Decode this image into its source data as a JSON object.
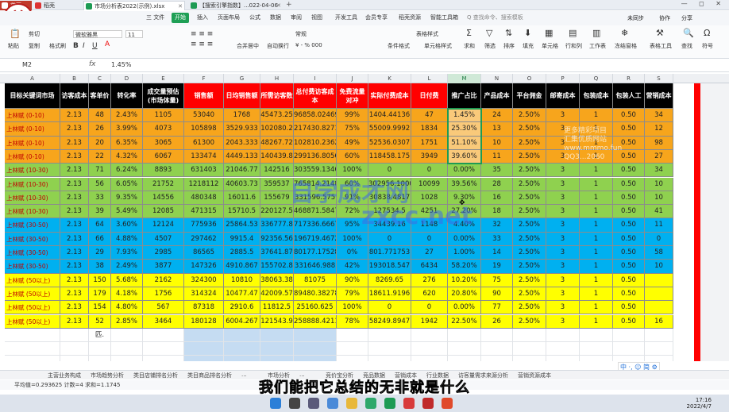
{
  "titlebar": {
    "tabs": [
      "首页",
      "稻壳",
      "市场分析表2022(示例).xlsx",
      "【搜索引擎指数】...022-04-06"
    ],
    "window_controls": "— ◻ ✕"
  },
  "ribbon": {
    "menus": [
      "三 文件",
      "开始",
      "插入",
      "页面布局",
      "公式",
      "数据",
      "审阅",
      "视图",
      "开发工具",
      "会员专享",
      "稻壳资源",
      "智能工具箱"
    ],
    "active_menu": "开始",
    "search_placeholder": "Q 查找命令、搜索模板",
    "right_tools": [
      "未同步",
      "协作",
      "分享"
    ]
  },
  "toolbar": {
    "paste": "粘贴",
    "cut": "剪切",
    "copy": "复制",
    "format_painter": "格式刷",
    "font_name": "微软雅黑",
    "font_size": "11",
    "merge": "合并居中",
    "wrap": "自动换行",
    "number_format": "常规",
    "table_style": "表格样式",
    "cond_format": "条件格式",
    "cell_style": "单元格样式",
    "sum": "求和",
    "filter": "筛选",
    "sort": "排序",
    "fill": "填充",
    "cell": "单元格",
    "rowcol": "行和列",
    "worksheet": "工作表",
    "freeze": "冻结窗格",
    "table_tools": "表格工具",
    "find": "查找",
    "symbol": "符号"
  },
  "formula_bar": {
    "name_box": "M2",
    "fx": "fx",
    "value": "1.45%"
  },
  "columns": [
    "A",
    "B",
    "C",
    "D",
    "E",
    "F",
    "G",
    "H",
    "I",
    "J",
    "K",
    "L",
    "M",
    "N",
    "O",
    "P",
    "Q",
    "R",
    "S"
  ],
  "selected_column": "M",
  "header_row": [
    "目标关键词市场",
    "访客成本",
    "客单价",
    "转化率",
    "成交量预估\n(市场体量)",
    "销售额",
    "日均销售额",
    "所需访客数",
    "总付费访客成本",
    "免费流量对冲",
    "实际付费成本",
    "日付费",
    "推广占比",
    "产品成本",
    "平台佣金",
    "邮寄成本",
    "包装成本",
    "包装人工",
    "营销成本"
  ],
  "rows": [
    [
      "上林赋 (0-10)",
      "2.13",
      "48",
      "2.43%",
      "1105",
      "53040",
      "1768",
      "45473.25",
      "96858.02469",
      "99%",
      "1404.44136",
      "47",
      "1.45%",
      "24",
      "2.50%",
      "3",
      "1",
      "0.50",
      "34"
    ],
    [
      "上林赋 (0-10)",
      "2.13",
      "26",
      "3.99%",
      "4073",
      "105898",
      "3529.933",
      "102080.2",
      "217430.8271",
      "75%",
      "55009.9992",
      "1834",
      "25.30%",
      "13",
      "2.50%",
      "3",
      "1",
      "0.50",
      "12"
    ],
    [
      "上林赋 (0-10)",
      "2.13",
      "20",
      "6.35%",
      "3065",
      "61300",
      "2043.333",
      "48267.72",
      "102810.2362",
      "49%",
      "52536.0307",
      "1751",
      "51.10%",
      "10",
      "2.50%",
      "3",
      "1",
      "0.50",
      "98"
    ],
    [
      "上林赋 (0-10)",
      "2.13",
      "22",
      "4.32%",
      "6067",
      "133474",
      "4449.133",
      "140439.8",
      "299136.8056",
      "60%",
      "118458.175",
      "3949",
      "39.60%",
      "11",
      "2.50%",
      "3",
      "1",
      "0.50",
      "27"
    ],
    [
      "上林赋 (10-30)",
      "2.13",
      "71",
      "6.24%",
      "8893",
      "631403",
      "21046.77",
      "142516",
      "303559.1346",
      "100%",
      "0",
      "0",
      "0.00%",
      "35",
      "2.50%",
      "3",
      "1",
      "0.50",
      "34"
    ],
    [
      "上林赋 (10-30)",
      "2.13",
      "56",
      "6.05%",
      "21752",
      "1218112",
      "40603.73",
      "359537",
      "765814.2148",
      "60%",
      "302956.1000",
      "10099",
      "39.56%",
      "28",
      "2.50%",
      "3",
      "1",
      "0.50",
      "10"
    ],
    [
      "上林赋 (10-30)",
      "2.13",
      "33",
      "9.35%",
      "14556",
      "480348",
      "16011.6",
      "155679",
      "331596.575",
      "91%",
      "30838.4817",
      "1028",
      "9.30%",
      "16",
      "2.50%",
      "3",
      "1",
      "0.50",
      "10"
    ],
    [
      "上林赋 (10-30)",
      "2.13",
      "39",
      "5.49%",
      "12085",
      "471315",
      "15710.5",
      "220127.5",
      "468871.5847",
      "72%",
      "127534.5",
      "4251",
      "27.20%",
      "18",
      "2.50%",
      "3",
      "1",
      "0.50",
      "41"
    ],
    [
      "上林赋 (30-50)",
      "2.13",
      "64",
      "3.60%",
      "12124",
      "775936",
      "25864.53",
      "336777.8",
      "717336.6667",
      "95%",
      "34439.16",
      "1148",
      "4.40%",
      "32",
      "2.50%",
      "3",
      "1",
      "0.50",
      "11"
    ],
    [
      "上林赋 (30-50)",
      "2.13",
      "66",
      "4.88%",
      "4507",
      "297462",
      "9915.4",
      "92356.56",
      "196719.4672",
      "100%",
      "0",
      "0",
      "0.00%",
      "33",
      "2.50%",
      "3",
      "1",
      "0.50",
      "0"
    ],
    [
      "上林赋 (30-50)",
      "2.13",
      "29",
      "7.93%",
      "2985",
      "86565",
      "2885.5",
      "37641.87",
      "80177.17528",
      "0%",
      "801.771753",
      "27",
      "1.00%",
      "14",
      "2.50%",
      "3",
      "1",
      "0.50",
      "58"
    ],
    [
      "上林赋 (30-50)",
      "2.13",
      "38",
      "2.49%",
      "3877",
      "147326",
      "4910.867",
      "155702.8",
      "331646.988",
      "42%",
      "193018.547",
      "6434",
      "58.20%",
      "19",
      "2.50%",
      "3",
      "1",
      "0.50",
      "10"
    ],
    [
      "上林赋 (50以上)",
      "2.13",
      "150",
      "5.68%",
      "2162",
      "324300",
      "10810",
      "38063.38",
      "81075",
      "90%",
      "8269.65",
      "276",
      "10.20%",
      "75",
      "2.50%",
      "3",
      "1",
      "0.50",
      ""
    ],
    [
      "上林赋 (50以上)",
      "2.13",
      "179",
      "4.18%",
      "1756",
      "314324",
      "10477.47",
      "42009.57",
      "89480.38278",
      "79%",
      "18611.9196",
      "620",
      "20.80%",
      "90",
      "2.50%",
      "3",
      "1",
      "0.50",
      ""
    ],
    [
      "上林赋 (50以上)",
      "2.13",
      "154",
      "4.80%",
      "567",
      "87318",
      "2910.6",
      "11812.5",
      "25160.625",
      "100%",
      "0",
      "0",
      "0.00%",
      "77",
      "2.50%",
      "3",
      "1",
      "0.50",
      ""
    ],
    [
      "上林赋 (50以上)",
      "2.13",
      "52",
      "2.85%",
      "3464",
      "180128",
      "6004.267",
      "121543.9",
      "258888.4211",
      "78%",
      "58249.8947",
      "1942",
      "22.50%",
      "26",
      "2.50%",
      "3",
      "1",
      "0.50",
      "16"
    ]
  ],
  "extra_cell": "匹.",
  "row_numbers": [
    "1",
    "",
    "",
    "",
    "",
    "",
    "",
    "",
    "",
    "",
    "",
    "",
    "",
    "",
    "",
    "",
    "",
    "",
    "",
    "",
    ""
  ],
  "colors": {
    "orange": "#f7a51c",
    "green": "#8fd14f",
    "blue": "#00b0f0",
    "yellow": "#ffff00",
    "header_black": "#000000",
    "header_red": "#ff0000",
    "header_orange": "#ff9900",
    "header_green": "#1d9b54",
    "light_blue": "#c5dcf2"
  },
  "sheet_tabs": [
    "主营业务构成",
    "市场趋势分析",
    "类目店铺排名分析",
    "类目商品排名分析",
    "...",
    "市场分析",
    "...",
    "竞价宝分析",
    "竞品数据",
    "营销成本",
    "行业数据",
    "访客量需求来源分析",
    "营销资源成本"
  ],
  "status": "平均值=0.293625  计数=4  求和=1.1745",
  "subtitle": "我们能把它总结的无非就是什么",
  "watermark_main": [
    "自学成才网",
    "zxcc.net"
  ],
  "watermark_side": [
    "更多精彩项目",
    "汇集优质网站",
    "www.mmmo.fun",
    "QQ3...2060"
  ],
  "seal_text": "善",
  "ime": "中 ·, ☺ 简 ⚙",
  "clock": {
    "time": "17:16",
    "date": "2022/4/7"
  }
}
